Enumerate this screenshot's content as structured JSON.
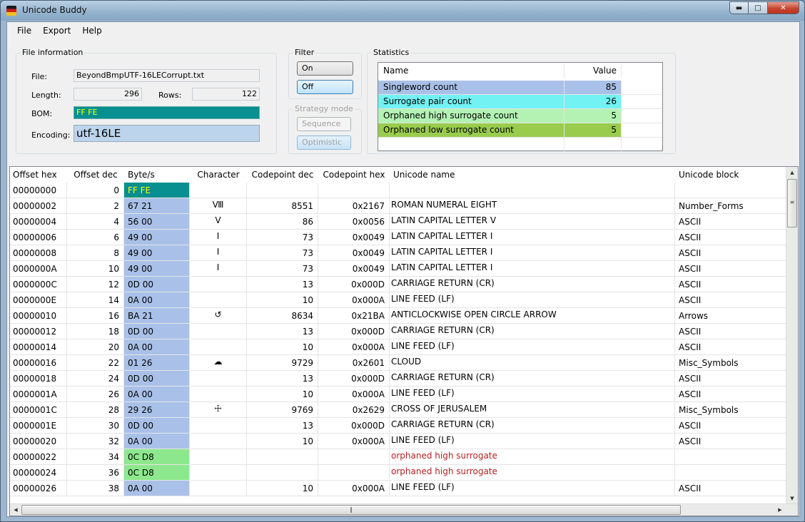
{
  "window": {
    "title": "Unicode Buddy"
  },
  "menu": [
    "File",
    "Export",
    "Help"
  ],
  "file_info": {
    "group_label": "File information",
    "file_label": "File:",
    "file_value": "BeyondBmpUTF-16LECorrupt.txt",
    "length_label": "Length:",
    "length_value": "296",
    "rows_label": "Rows:",
    "rows_value": "122",
    "bom_label": "BOM:",
    "bom_value": "FF FE",
    "encoding_label": "Encoding:",
    "encoding_value": "utf-16LE"
  },
  "filter": {
    "group_label": "Filter",
    "on_label": "On",
    "off_label": "Off"
  },
  "strategy": {
    "group_label": "Strategy mode",
    "sequence_label": "Sequence",
    "optimistic_label": "Optimistic"
  },
  "statistics": {
    "group_label": "Statistics",
    "col_name": "Name",
    "col_value": "Value",
    "rows": [
      {
        "name": "Singleword count",
        "value": "85",
        "color": "#a9c1e8"
      },
      {
        "name": "Surrogate pair count",
        "value": "26",
        "color": "#72f2f2"
      },
      {
        "name": "Orphaned high surrogate count",
        "value": "5",
        "color": "#b3f2b3"
      },
      {
        "name": "Orphaned low surrogate count",
        "value": "5",
        "color": "#99cc4d"
      }
    ]
  },
  "grid": {
    "headers": [
      "Offset hex",
      "Offset dec",
      "Byte/s",
      "Character",
      "Codepoint dec",
      "Codepoint hex",
      "Unicode name",
      "Unicode block"
    ],
    "rows": [
      [
        "00000000",
        "0",
        "FF FE",
        "",
        "",
        "",
        "",
        ""
      ],
      [
        "00000002",
        "2",
        "67 21",
        "Ⅷ",
        "8551",
        "0x2167",
        "ROMAN NUMERAL EIGHT",
        "Number_Forms"
      ],
      [
        "00000004",
        "4",
        "56 00",
        "V",
        "86",
        "0x0056",
        "LATIN CAPITAL LETTER V",
        "ASCII"
      ],
      [
        "00000006",
        "6",
        "49 00",
        "I",
        "73",
        "0x0049",
        "LATIN CAPITAL LETTER I",
        "ASCII"
      ],
      [
        "00000008",
        "8",
        "49 00",
        "I",
        "73",
        "0x0049",
        "LATIN CAPITAL LETTER I",
        "ASCII"
      ],
      [
        "0000000A",
        "10",
        "49 00",
        "I",
        "73",
        "0x0049",
        "LATIN CAPITAL LETTER I",
        "ASCII"
      ],
      [
        "0000000C",
        "12",
        "0D 00",
        "",
        "13",
        "0x000D",
        "CARRIAGE RETURN (CR)",
        "ASCII"
      ],
      [
        "0000000E",
        "14",
        "0A 00",
        "",
        "10",
        "0x000A",
        "LINE FEED (LF)",
        "ASCII"
      ],
      [
        "00000010",
        "16",
        "BA 21",
        "↺",
        "8634",
        "0x21BA",
        "ANTICLOCKWISE OPEN CIRCLE ARROW",
        "Arrows"
      ],
      [
        "00000012",
        "18",
        "0D 00",
        "",
        "13",
        "0x000D",
        "CARRIAGE RETURN (CR)",
        "ASCII"
      ],
      [
        "00000014",
        "20",
        "0A 00",
        "",
        "10",
        "0x000A",
        "LINE FEED (LF)",
        "ASCII"
      ],
      [
        "00000016",
        "22",
        "01 26",
        "☁",
        "9729",
        "0x2601",
        "CLOUD",
        "Misc_Symbols"
      ],
      [
        "00000018",
        "24",
        "0D 00",
        "",
        "13",
        "0x000D",
        "CARRIAGE RETURN (CR)",
        "ASCII"
      ],
      [
        "0000001A",
        "26",
        "0A 00",
        "",
        "10",
        "0x000A",
        "LINE FEED (LF)",
        "ASCII"
      ],
      [
        "0000001C",
        "28",
        "29 26",
        "☩",
        "9769",
        "0x2629",
        "CROSS OF JERUSALEM",
        "Misc_Symbols"
      ],
      [
        "0000001E",
        "30",
        "0D 00",
        "",
        "13",
        "0x000D",
        "CARRIAGE RETURN (CR)",
        "ASCII"
      ],
      [
        "00000020",
        "32",
        "0A 00",
        "",
        "10",
        "0x000A",
        "LINE FEED (LF)",
        "ASCII"
      ],
      [
        "00000022",
        "34",
        "0C D8",
        "",
        "",
        "",
        "orphaned high surrogate",
        ""
      ],
      [
        "00000024",
        "36",
        "0C D8",
        "",
        "",
        "",
        "orphaned high surrogate",
        ""
      ],
      [
        "00000026",
        "38",
        "0A 00",
        "",
        "10",
        "0x000A",
        "LINE FEED (LF)",
        "ASCII"
      ]
    ],
    "byte_colors": [
      "#088f8f",
      "#a9c1e8",
      "#a9c1e8",
      "#a9c1e8",
      "#a9c1e8",
      "#a9c1e8",
      "#a9c1e8",
      "#a9c1e8",
      "#a9c1e8",
      "#a9c1e8",
      "#a9c1e8",
      "#a9c1e8",
      "#a9c1e8",
      "#a9c1e8",
      "#a9c1e8",
      "#a9c1e8",
      "#a9c1e8",
      "#8de88d",
      "#8de88d",
      "#a9c1e8"
    ],
    "bom_text_color": "#ffff00",
    "orphan_text_color": "#b22222"
  },
  "icons": {
    "app": "app-flag-icon",
    "minimize": "minimize-icon",
    "maximize": "maximize-icon",
    "close": "close-icon"
  }
}
